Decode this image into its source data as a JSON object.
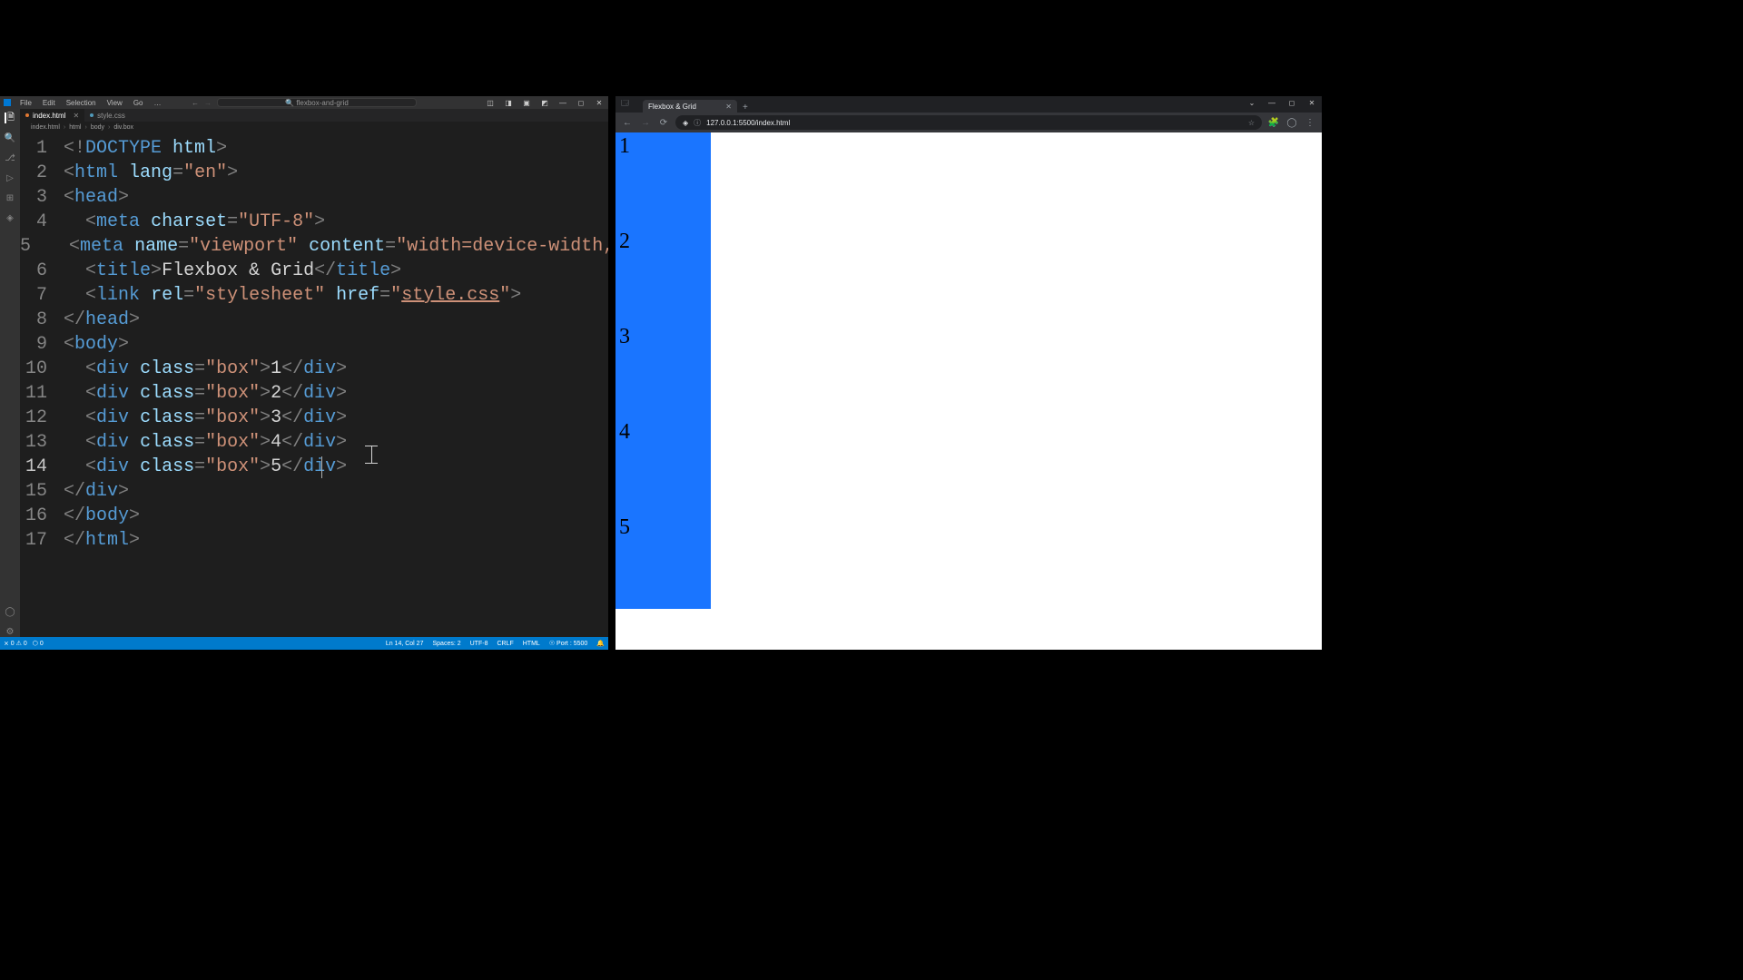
{
  "vscode": {
    "menu": [
      "File",
      "Edit",
      "Selection",
      "View",
      "Go",
      "…"
    ],
    "search_placeholder": "flexbox-and-grid",
    "tabs": [
      {
        "label": "index.html",
        "active": true
      },
      {
        "label": "style.css",
        "active": false
      }
    ],
    "breadcrumb": [
      "index.html",
      "html",
      "body",
      "div.box"
    ],
    "code": [
      {
        "n": 1,
        "seg": [
          [
            "punc",
            "<!"
          ],
          [
            "doctype",
            "DOCTYPE"
          ],
          [
            "text",
            " "
          ],
          [
            "attr",
            "html"
          ],
          [
            "punc",
            ">"
          ]
        ]
      },
      {
        "n": 2,
        "seg": [
          [
            "punc",
            "<"
          ],
          [
            "tag",
            "html"
          ],
          [
            "text",
            " "
          ],
          [
            "attr",
            "lang"
          ],
          [
            "punc",
            "="
          ],
          [
            "str",
            "\"en\""
          ],
          [
            "punc",
            ">"
          ]
        ]
      },
      {
        "n": 3,
        "seg": [
          [
            "punc",
            "<"
          ],
          [
            "tag",
            "head"
          ],
          [
            "punc",
            ">"
          ]
        ]
      },
      {
        "n": 4,
        "seg": [
          [
            "text",
            "  "
          ],
          [
            "punc",
            "<"
          ],
          [
            "tag",
            "meta"
          ],
          [
            "text",
            " "
          ],
          [
            "attr",
            "charset"
          ],
          [
            "punc",
            "="
          ],
          [
            "str",
            "\"UTF-8\""
          ],
          [
            "punc",
            ">"
          ]
        ]
      },
      {
        "n": 5,
        "seg": [
          [
            "text",
            "  "
          ],
          [
            "punc",
            "<"
          ],
          [
            "tag",
            "meta"
          ],
          [
            "text",
            " "
          ],
          [
            "attr",
            "name"
          ],
          [
            "punc",
            "="
          ],
          [
            "str",
            "\"viewport\""
          ],
          [
            "text",
            " "
          ],
          [
            "attr",
            "content"
          ],
          [
            "punc",
            "="
          ],
          [
            "str",
            "\"width=device-width,"
          ]
        ]
      },
      {
        "n": 6,
        "seg": [
          [
            "text",
            "  "
          ],
          [
            "punc",
            "<"
          ],
          [
            "tag",
            "title"
          ],
          [
            "punc",
            ">"
          ],
          [
            "text",
            "Flexbox & Grid"
          ],
          [
            "punc",
            "</"
          ],
          [
            "tag",
            "title"
          ],
          [
            "punc",
            ">"
          ]
        ]
      },
      {
        "n": 7,
        "seg": [
          [
            "text",
            "  "
          ],
          [
            "punc",
            "<"
          ],
          [
            "tag",
            "link"
          ],
          [
            "text",
            " "
          ],
          [
            "attr",
            "rel"
          ],
          [
            "punc",
            "="
          ],
          [
            "str",
            "\"stylesheet\""
          ],
          [
            "text",
            " "
          ],
          [
            "attr",
            "href"
          ],
          [
            "punc",
            "="
          ],
          [
            "str",
            "\""
          ],
          [
            "link",
            "style.css"
          ],
          [
            "str",
            "\""
          ],
          [
            "punc",
            ">"
          ]
        ]
      },
      {
        "n": 8,
        "seg": [
          [
            "punc",
            "</"
          ],
          [
            "tag",
            "head"
          ],
          [
            "punc",
            ">"
          ]
        ]
      },
      {
        "n": 9,
        "seg": [
          [
            "punc",
            "<"
          ],
          [
            "tag",
            "body"
          ],
          [
            "punc",
            ">"
          ]
        ]
      },
      {
        "n": 10,
        "seg": [
          [
            "text",
            "  "
          ],
          [
            "punc",
            "<"
          ],
          [
            "tag",
            "div"
          ],
          [
            "text",
            " "
          ],
          [
            "attr",
            "class"
          ],
          [
            "punc",
            "="
          ],
          [
            "str",
            "\"box\""
          ],
          [
            "punc",
            ">"
          ],
          [
            "text",
            "1"
          ],
          [
            "punc",
            "</"
          ],
          [
            "tag",
            "div"
          ],
          [
            "punc",
            ">"
          ]
        ]
      },
      {
        "n": 11,
        "seg": [
          [
            "text",
            "  "
          ],
          [
            "punc",
            "<"
          ],
          [
            "tag",
            "div"
          ],
          [
            "text",
            " "
          ],
          [
            "attr",
            "class"
          ],
          [
            "punc",
            "="
          ],
          [
            "str",
            "\"box\""
          ],
          [
            "punc",
            ">"
          ],
          [
            "text",
            "2"
          ],
          [
            "punc",
            "</"
          ],
          [
            "tag",
            "div"
          ],
          [
            "punc",
            ">"
          ]
        ]
      },
      {
        "n": 12,
        "seg": [
          [
            "text",
            "  "
          ],
          [
            "punc",
            "<"
          ],
          [
            "tag",
            "div"
          ],
          [
            "text",
            " "
          ],
          [
            "attr",
            "class"
          ],
          [
            "punc",
            "="
          ],
          [
            "str",
            "\"box\""
          ],
          [
            "punc",
            ">"
          ],
          [
            "text",
            "3"
          ],
          [
            "punc",
            "</"
          ],
          [
            "tag",
            "div"
          ],
          [
            "punc",
            ">"
          ]
        ]
      },
      {
        "n": 13,
        "seg": [
          [
            "text",
            "  "
          ],
          [
            "punc",
            "<"
          ],
          [
            "tag",
            "div"
          ],
          [
            "text",
            " "
          ],
          [
            "attr",
            "class"
          ],
          [
            "punc",
            "="
          ],
          [
            "str",
            "\"box\""
          ],
          [
            "punc",
            ">"
          ],
          [
            "text",
            "4"
          ],
          [
            "punc",
            "</"
          ],
          [
            "tag",
            "div"
          ],
          [
            "punc",
            ">"
          ]
        ]
      },
      {
        "n": 14,
        "seg": [
          [
            "text",
            "  "
          ],
          [
            "punc",
            "<"
          ],
          [
            "tag",
            "div"
          ],
          [
            "text",
            " "
          ],
          [
            "attr",
            "class"
          ],
          [
            "punc",
            "="
          ],
          [
            "str",
            "\"box\""
          ],
          [
            "punc",
            ">"
          ],
          [
            "text",
            "5"
          ],
          [
            "punc",
            "</"
          ],
          [
            "tag",
            "div"
          ],
          [
            "punc",
            ">"
          ]
        ],
        "current": true
      },
      {
        "n": 15,
        "seg": [
          [
            "punc",
            "</"
          ],
          [
            "tag",
            "div"
          ],
          [
            "punc",
            ">"
          ]
        ]
      },
      {
        "n": 16,
        "seg": [
          [
            "punc",
            "</"
          ],
          [
            "tag",
            "body"
          ],
          [
            "punc",
            ">"
          ]
        ]
      },
      {
        "n": 17,
        "seg": [
          [
            "punc",
            "</"
          ],
          [
            "tag",
            "html"
          ],
          [
            "punc",
            ">"
          ]
        ]
      }
    ],
    "status_left": [
      "⨯ 0 ⚠ 0",
      "⬡ 0"
    ],
    "status_right": [
      "Ln 14, Col 27",
      "Spaces: 2",
      "UTF-8",
      "CRLF",
      "HTML",
      "☉ Port : 5500",
      "🔔"
    ]
  },
  "browser": {
    "tab_title": "Flexbox & Grid",
    "url": "127.0.0.1:5500/index.html",
    "boxes": [
      "1",
      "2",
      "3",
      "4",
      "5"
    ]
  }
}
